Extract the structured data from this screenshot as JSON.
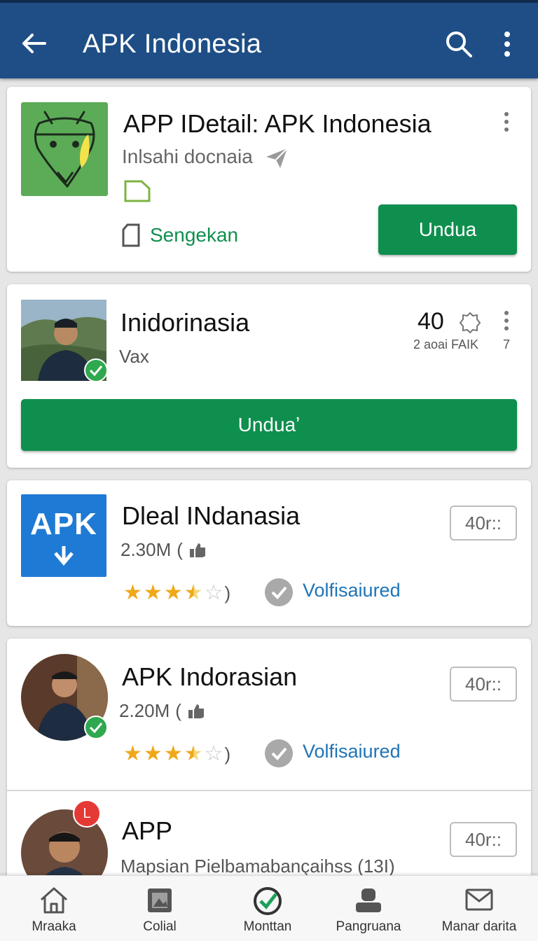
{
  "appbar": {
    "title": "APK Indonesia"
  },
  "card1": {
    "title": "APP IDetail: APK Indonesia",
    "subtitle": "Inlsahi docnaia",
    "link": "Sengekan",
    "button": "Undua"
  },
  "card2": {
    "title": "Inidorinasia",
    "subtitle": "Vax",
    "count": "40",
    "meta": "2 aoai FAIK",
    "meta_num": "7",
    "button": "Unduaʼ"
  },
  "card3": {
    "title": "Dleal INdanasia",
    "size": "2.30M",
    "size_open": "(",
    "rating_close": ")",
    "verified": "Volfisaiured",
    "pill": "40r::",
    "icon_text": "APK",
    "rating_stars": 3.5
  },
  "card4": {
    "title": "APK Indorasian",
    "size": "2.20M",
    "size_open": "(",
    "rating_close": ")",
    "verified": "Volfisaiured",
    "pill": "40r::",
    "rating_stars": 3.5
  },
  "card5": {
    "title": "APP",
    "subtitle": "Mapsian Pielbamabançaihss (13I)",
    "pill": "40r::",
    "badge": "L"
  },
  "bottomnav": {
    "items": [
      {
        "label": "Mraaka"
      },
      {
        "label": "Colial"
      },
      {
        "label": "Monttan"
      },
      {
        "label": "Pangruana"
      },
      {
        "label": "Manar darita"
      }
    ]
  },
  "colors": {
    "appbar": "#1f4e86",
    "primary_button": "#0f8f4e",
    "verified_text": "#1e74b8",
    "star": "#f0a81a"
  }
}
